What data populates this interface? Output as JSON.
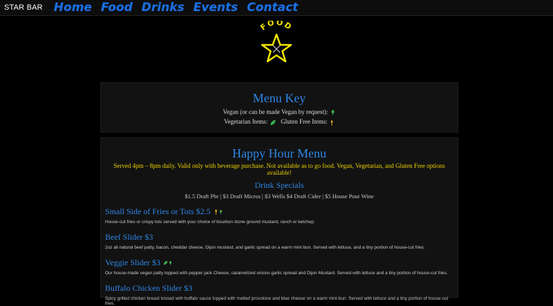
{
  "nav": {
    "brand": "STAR BAR",
    "links": [
      "Home",
      "Food",
      "Drinks",
      "Events",
      "Contact"
    ]
  },
  "logo": {
    "text": "FOOD"
  },
  "menu_key": {
    "title": "Menu Key",
    "vegan": "Vegan (or can be made Vegan by request):",
    "vegetarian": "Vegetarian Items:",
    "gluten_free": "Gluten Free Items:"
  },
  "happy_hour": {
    "title": "Happy Hour Menu",
    "served": "Served 4pm – 8pm daily. Valid only with beverage purchase. Not available as to go food. Vegan, Vegetarian, and Gluten Free options available!",
    "drink_specials_title": "Drink Specials",
    "drink_specials": "$1.5 Draft Pbr | $3 Draft Micros | $3 Wells $4 Draft Cider | $5 House Pour Wine",
    "items": [
      {
        "title": "Small Side of Fries or Tots $2.5",
        "desc": "House-cut fries or crispy tots served with your choice of bourbon stone ground mustard, ranch or ketchup."
      },
      {
        "title": "Beef Slider $3",
        "desc": "2oz all natural beef patty, bacon, cheddar cheese, Dijon mustard, and garlic spread on a warm mini bun. Served with lettuce, and a tiny portion of house-cut fries."
      },
      {
        "title": "Veggie Slider $3",
        "desc": "Our house-made vegan patty topped with pepper jack Cheese, caramelized onions garlic spread and Dijon Mustard. Served with lettuce and a tiny portion of house-cut fries."
      },
      {
        "title": "Buffalo Chicken Slider $3",
        "desc": "Spicy grilled chicken breast tossed with buffalo sauce topped with melted provolone and blue cheese on a warm mini-bun. Served with lettuce and a tiny portion of house-cut fries."
      }
    ]
  },
  "colors": {
    "accent": "#2f86e6",
    "nav_link": "#1c6fe0",
    "served": "#f0d400",
    "star": "#f5e800"
  }
}
